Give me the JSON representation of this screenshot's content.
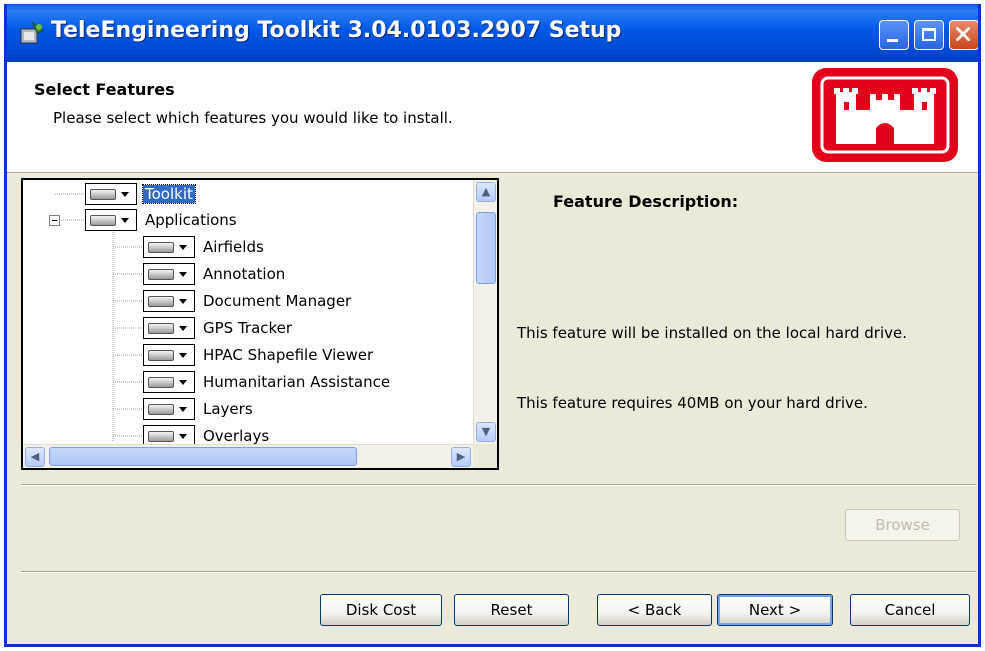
{
  "window": {
    "title": "TeleEngineering Toolkit 3.04.0103.2907 Setup",
    "title_icon": "setup-package-icon",
    "controls": [
      "minimize-icon",
      "maximize-icon",
      "close-icon"
    ]
  },
  "header": {
    "title": "Select Features",
    "subtitle": "Please select which features you would like to install.",
    "logo": "usace-castle-logo"
  },
  "tree": {
    "items": [
      {
        "label": "Toolkit",
        "selected": true
      },
      {
        "label": "Applications"
      },
      {
        "label": "Airfields"
      },
      {
        "label": "Annotation"
      },
      {
        "label": "Document Manager"
      },
      {
        "label": "GPS Tracker"
      },
      {
        "label": "HPAC Shapefile Viewer"
      },
      {
        "label": "Humanitarian Assistance"
      },
      {
        "label": "Layers"
      },
      {
        "label": "Overlays"
      }
    ]
  },
  "description": {
    "title": "Feature Description:",
    "install_text": "This feature will be installed on the local hard drive.",
    "size_text": "This feature requires 40MB on your hard drive."
  },
  "buttons": {
    "browse": "Browse",
    "disk_cost": "Disk Cost",
    "reset": "Reset",
    "back": "< Back",
    "next": "Next >",
    "cancel": "Cancel"
  },
  "colors": {
    "titlebar": "#0058e6",
    "dialog_bg": "#ece9d8",
    "selection": "#316ac5",
    "logo_red": "#e2001a"
  }
}
